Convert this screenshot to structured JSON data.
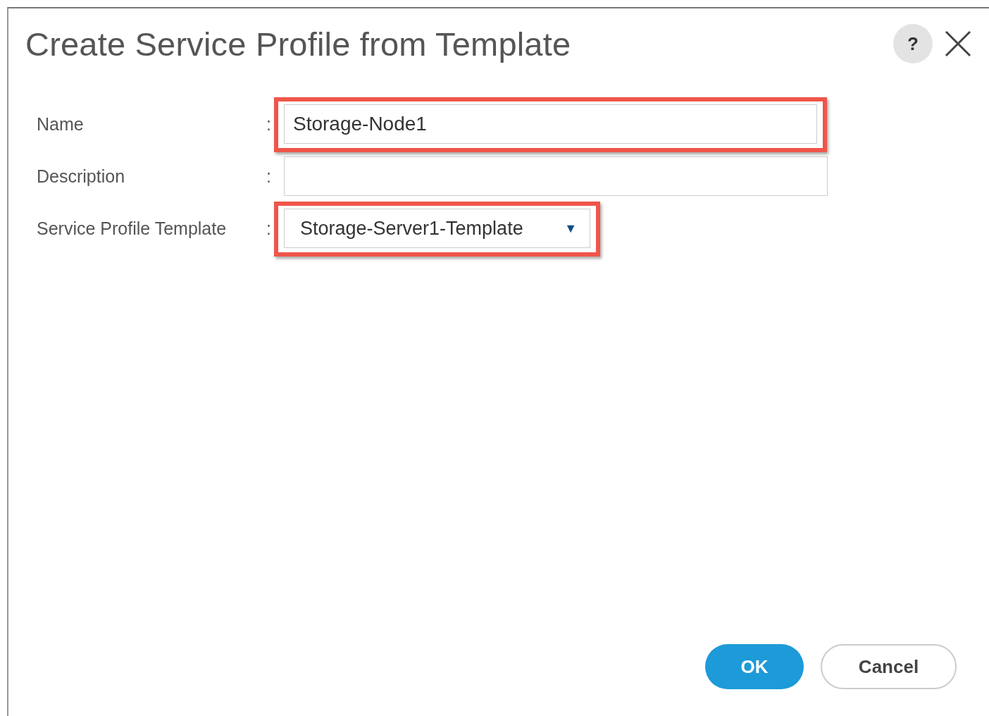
{
  "dialog": {
    "title": "Create Service Profile from Template",
    "help": "?"
  },
  "fields": [
    {
      "kind": "text",
      "label": "Name",
      "separator": ":",
      "value": "Storage-Node1",
      "highlighted": true
    },
    {
      "kind": "text",
      "label": "Description",
      "separator": ":",
      "highlighted": false
    },
    {
      "kind": "select",
      "label": "Service Profile Template",
      "separator": ":",
      "value": "Storage-Server1-Template",
      "arrow": "▼",
      "highlighted": true
    }
  ],
  "buttons": [
    {
      "label": "OK",
      "kind": "primary"
    },
    {
      "label": "Cancel",
      "kind": "secondary"
    }
  ]
}
